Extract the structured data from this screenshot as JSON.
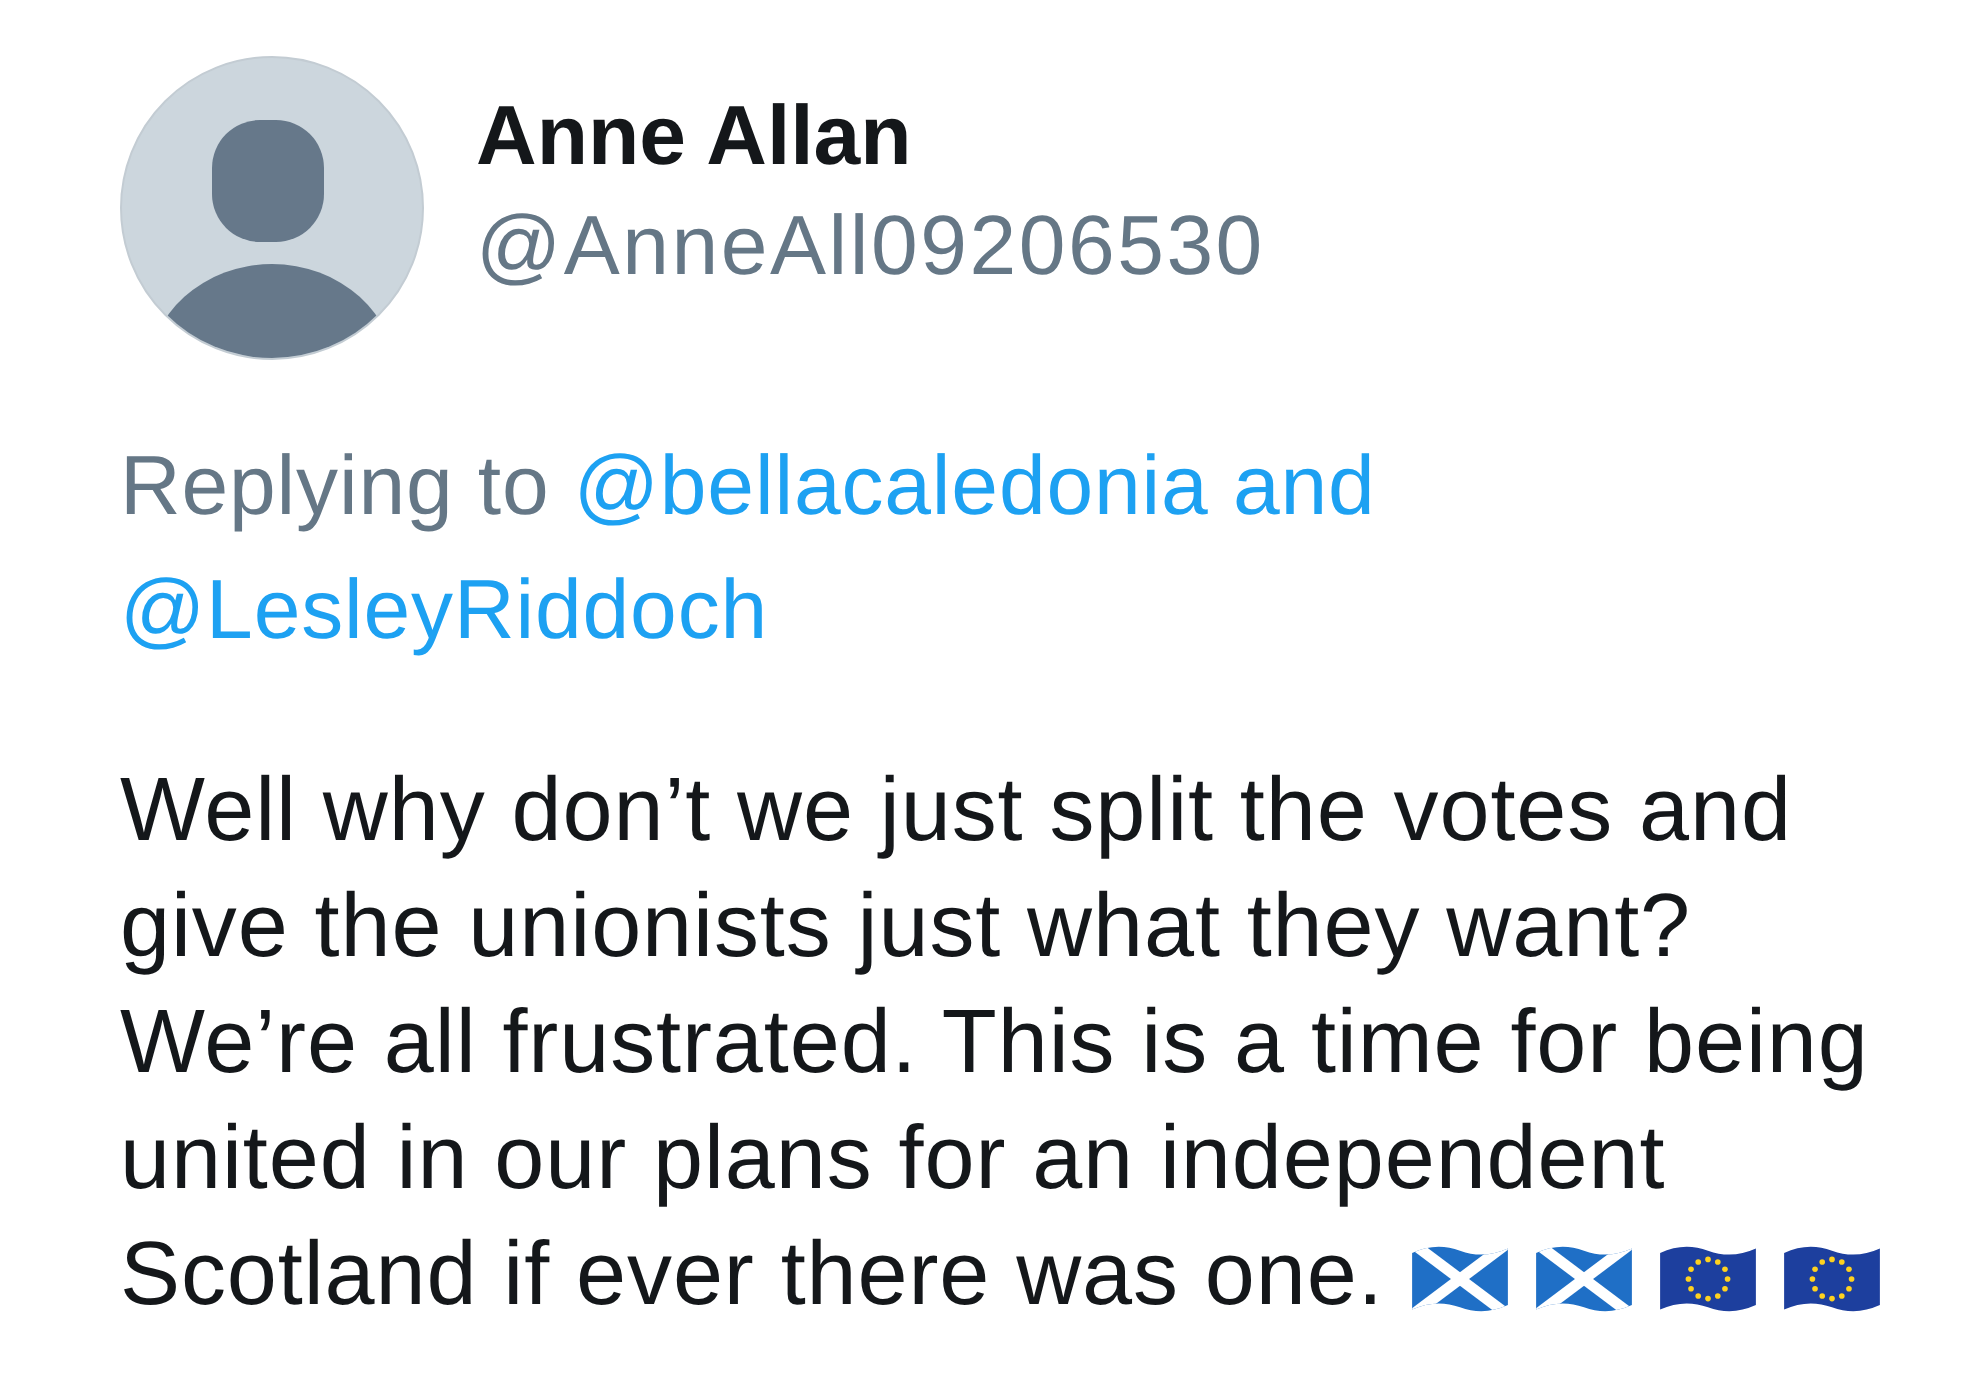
{
  "author": {
    "name": "Anne Allan",
    "handle": "@AnneAll09206530"
  },
  "reply_context": {
    "prefix": "Replying to",
    "mentions": [
      "@bellacaledonia",
      "@LesleyRiddoch"
    ],
    "joiner": "and"
  },
  "tweet": {
    "text": "Well why don’t we just split the votes and give the unionists just what they want? We’re all frustrated. This is a time for being united in our plans for an independent Scotland if ever there was one.",
    "emoji": [
      {
        "kind": "saltire"
      },
      {
        "kind": "saltire"
      },
      {
        "kind": "star_ring"
      },
      {
        "kind": "star_ring"
      }
    ]
  }
}
